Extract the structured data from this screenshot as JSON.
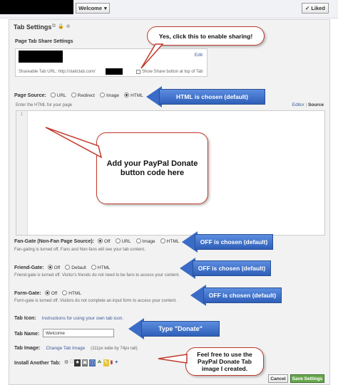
{
  "topbar": {
    "welcome_label": "Welcome",
    "liked_label": "Liked"
  },
  "tab_settings": {
    "title": "Tab Settings"
  },
  "share": {
    "heading": "Page Tab Share Settings",
    "edit_label": "Edit",
    "url_label": "Shareable Tab URL:",
    "url_value": "http://statictab.com/",
    "checkbox_label": "Show Share button at top of Tab"
  },
  "page_source": {
    "label": "Page Source:",
    "options": [
      "URL",
      "Redirect",
      "Image",
      "HTML"
    ],
    "selected": "HTML",
    "hint": "Enter the HTML for your page",
    "editor_label": "Editor",
    "source_label": "Source",
    "line_number": "1"
  },
  "fan_gate": {
    "label": "Fan-Gate (Non-Fan Page Source):",
    "options": [
      "Off",
      "URL",
      "Image",
      "HTML"
    ],
    "selected": "Off",
    "note": "Fan-gating is turned off. Fans and Non-fans will see your tab content."
  },
  "friend_gate": {
    "label": "Friend-Gate:",
    "options": [
      "Off",
      "Default",
      "HTML"
    ],
    "selected": "Off",
    "note": "Friend-gate is turned off. Visitor's friends do not need to be fans to access your content."
  },
  "form_gate": {
    "label": "Form-Gate:",
    "options": [
      "Off",
      "HTML"
    ],
    "selected": "Off",
    "note": "Form-gate is turned off. Visitors do not complete an input form to access your content."
  },
  "tab_icon": {
    "label": "Tab Icon:",
    "link": "Instructions for using your own tab icon."
  },
  "tab_name": {
    "label": "Tab Name:",
    "value": "Welcome"
  },
  "tab_image": {
    "label": "Tab Image:",
    "link": "Change Tab Image",
    "size_note": "(111px wide by 74px tall)"
  },
  "install": {
    "label": "Install Another Tab:"
  },
  "buttons": {
    "cancel": "Cancel",
    "save": "Save Settings"
  },
  "annotations": {
    "share_callout": "Yes, click this to enable sharing!",
    "paypal_callout": "Add your PayPal Donate button code here",
    "html_arrow": "HTML is chosen (default)",
    "fan_arrow": "OFF is chosen (default)",
    "friend_arrow": "OFF is chosen (default)",
    "form_arrow": "OFF is chosen (default)",
    "name_arrow": "Type \"Donate\"",
    "image_callout": "Feel free to use the PayPal Donate Tab image I created."
  },
  "colors": {
    "arrow_blue": "#3a6bc6",
    "callout_border": "#c0392b",
    "link": "#3b5998",
    "save_green": "#69a74e"
  }
}
